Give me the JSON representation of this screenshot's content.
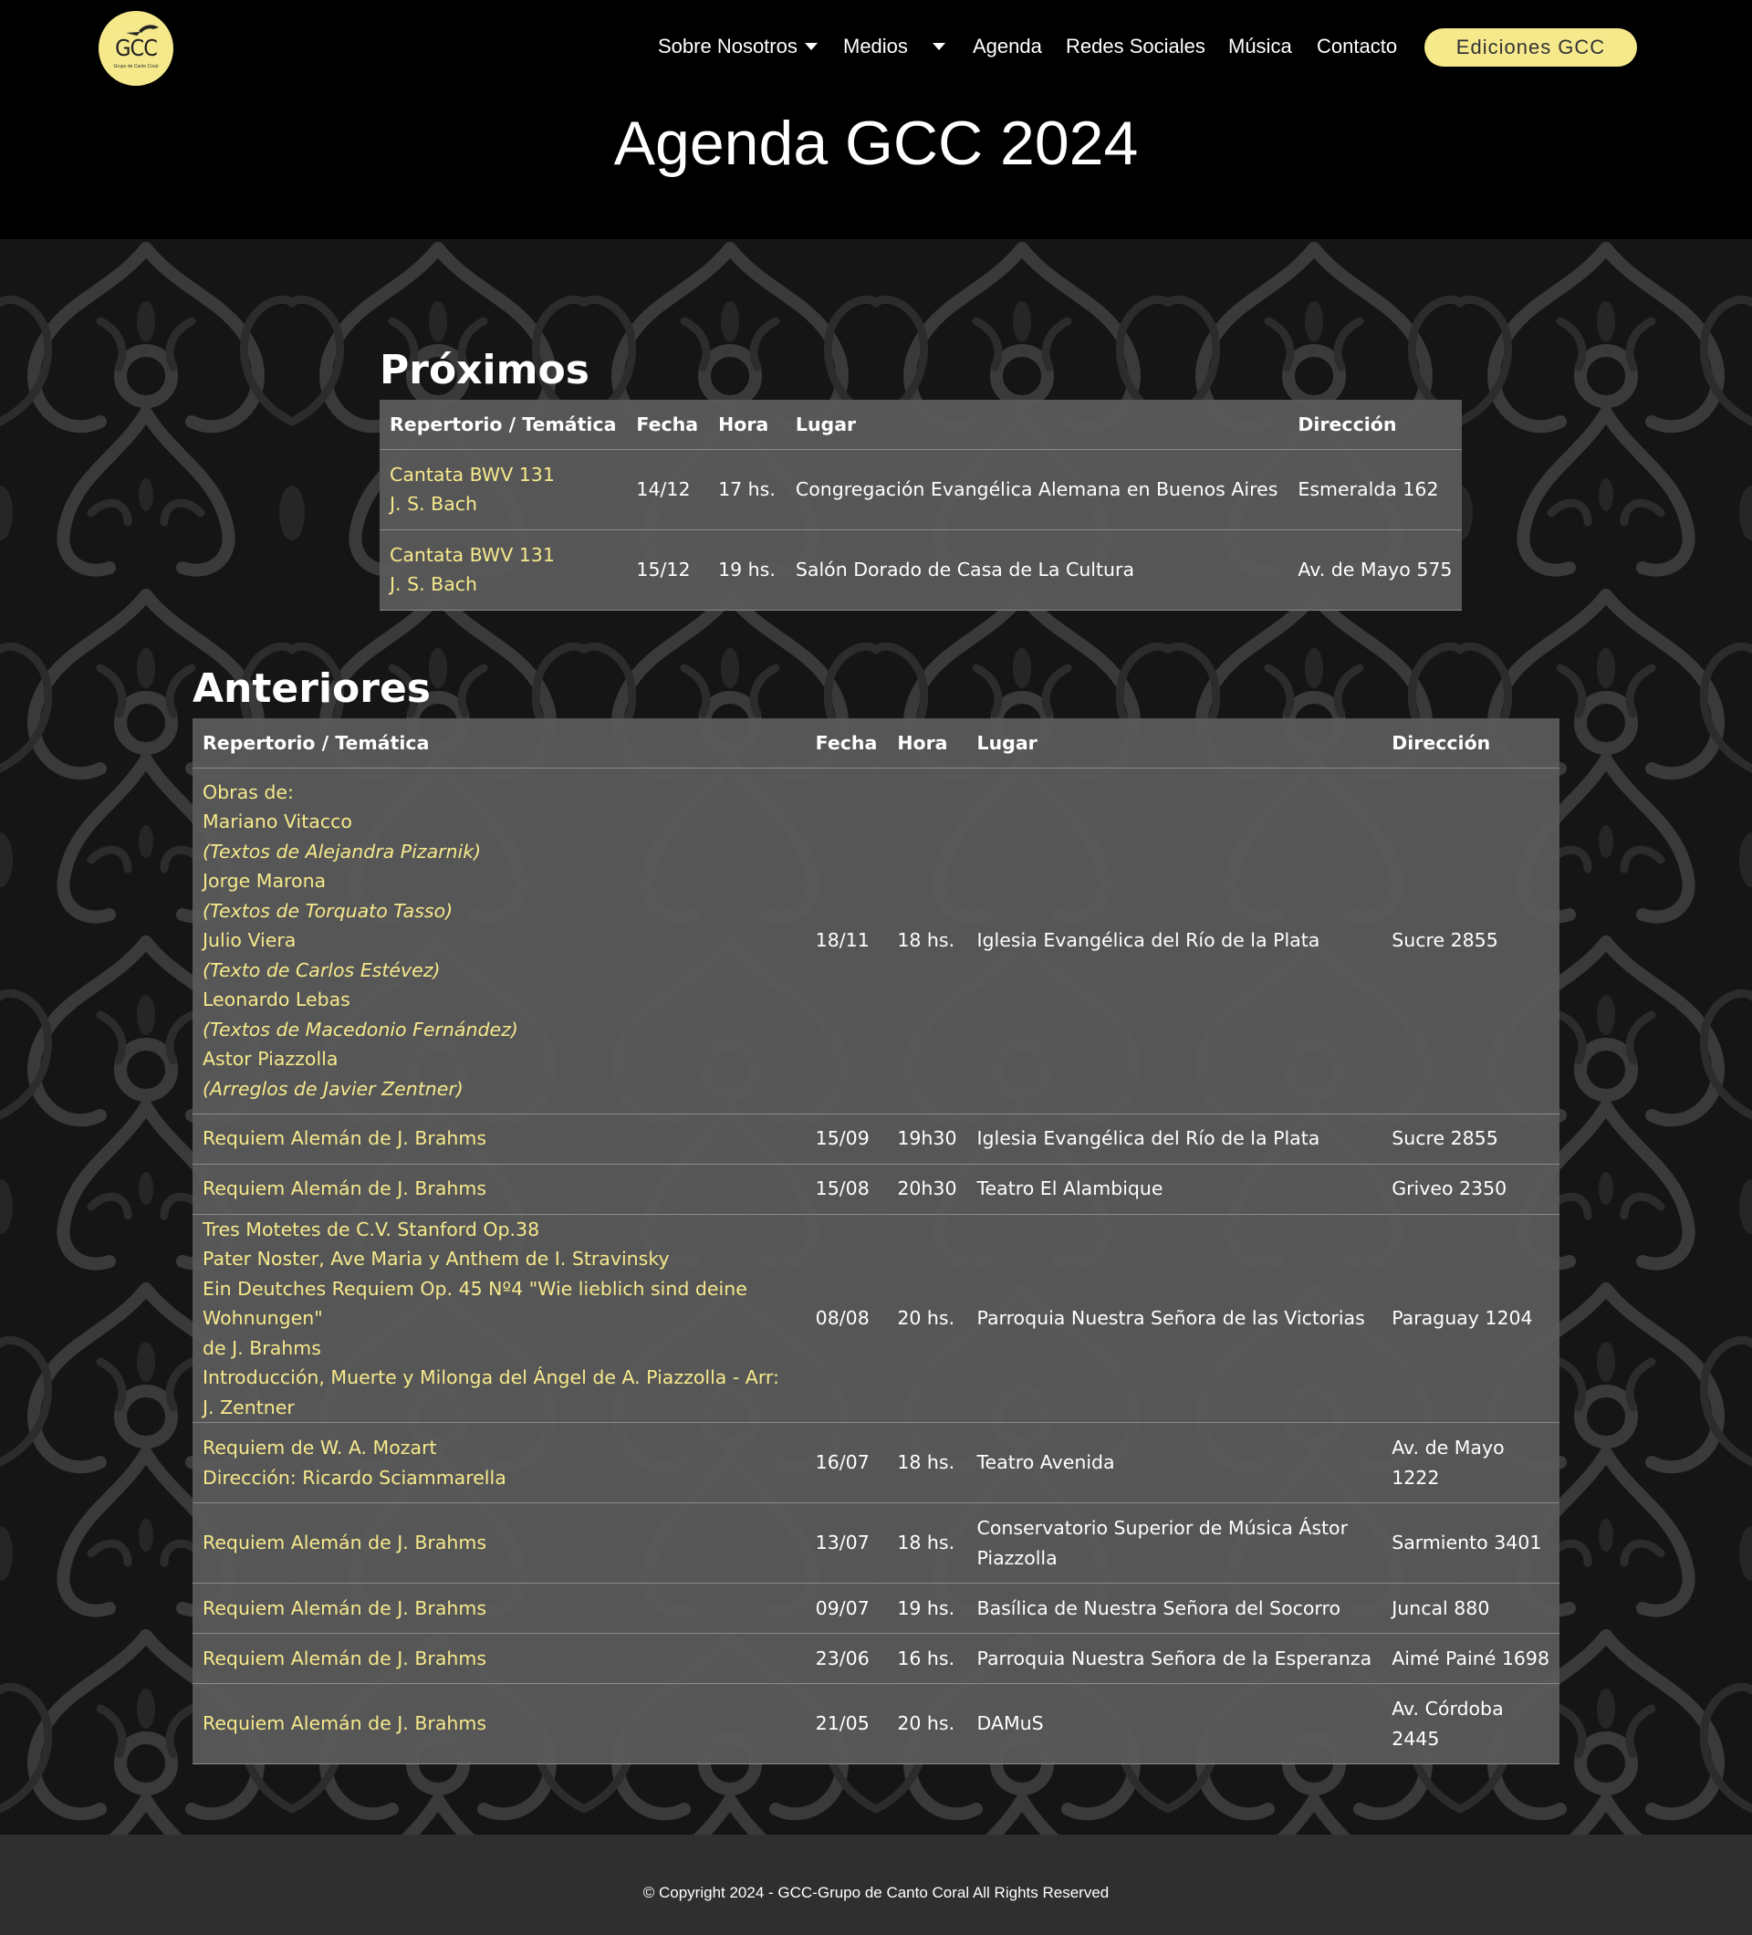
{
  "header": {
    "logo_text": "GCC",
    "logo_subtext": "Grupo de Canto Coral",
    "nav": {
      "sobre": "Sobre Nosotros",
      "medios": "Medios",
      "agenda": "Agenda",
      "redes": "Redes Sociales",
      "musica": "Música",
      "contacto": "Contacto"
    },
    "cta": "Ediciones GCC"
  },
  "page_title": "Agenda GCC 2024",
  "columns": {
    "rep": "Repertorio / Temática",
    "fecha": "Fecha",
    "hora": "Hora",
    "lugar": "Lugar",
    "dir": "Dirección"
  },
  "proximos": {
    "title": "Próximos",
    "rows": [
      {
        "rep1": "Cantata BWV 131",
        "rep2": "J. S. Bach",
        "fecha": "14/12",
        "hora": "17 hs.",
        "lugar": "Congregación Evangélica Alemana en Buenos Aires",
        "dir": "Esmeralda 162"
      },
      {
        "rep1": "Cantata BWV 131",
        "rep2": "J. S. Bach",
        "fecha": "15/12",
        "hora": "19 hs.",
        "lugar": "Salón Dorado de Casa de La Cultura",
        "dir": "Av. de Mayo 575"
      }
    ]
  },
  "anteriores": {
    "title": "Anteriores",
    "row1": {
      "lines": [
        "Obras de:",
        "Mariano Vitacco",
        "(Textos de Alejandra Pizarnik)",
        "Jorge Marona",
        "(Textos de Torquato Tasso)",
        "Julio Viera",
        "(Texto de Carlos Estévez)",
        "Leonardo Lebas",
        "(Textos de Macedonio Fernández)",
        "Astor Piazzolla",
        "(Arreglos de Javier Zentner)"
      ],
      "fecha": "18/11",
      "hora": "18 hs.",
      "lugar": "Iglesia Evangélica del Río de la Plata",
      "dir": "Sucre 2855"
    },
    "row2": {
      "rep": "Requiem Alemán de J. Brahms",
      "fecha": "15/09",
      "hora": "19h30",
      "lugar": "Iglesia Evangélica del Río de la Plata",
      "dir": "Sucre 2855"
    },
    "row3": {
      "rep": "Requiem Alemán de J. Brahms",
      "fecha": "15/08",
      "hora": "20h30",
      "lugar": "Teatro El Alambique",
      "dir": "Griveo 2350"
    },
    "row4": {
      "lines": [
        "Tres Motetes de C.V. Stanford Op.38",
        "Pater Noster, Ave Maria y Anthem de I. Stravinsky",
        "Ein Deutches Requiem Op. 45 Nº4 \"Wie lieblich sind deine Wohnungen\"",
        "de J. Brahms",
        "Introducción, Muerte y Milonga del Ángel de A. Piazzolla - Arr: J. Zentner"
      ],
      "fecha": "08/08",
      "hora": "20 hs.",
      "lugar": "Parroquia Nuestra Señora de las Victorias",
      "dir": "Paraguay 1204"
    },
    "row5": {
      "rep1": "Requiem de W. A. Mozart",
      "rep2": "Dirección: Ricardo Sciammarella",
      "fecha": "16/07",
      "hora": "18 hs.",
      "lugar": "Teatro Avenida",
      "dir1": "Av. de Mayo",
      "dir2": "1222"
    },
    "row6": {
      "rep": "Requiem Alemán de J. Brahms",
      "fecha": "13/07",
      "hora": "18 hs.",
      "lugar1": "Conservatorio Superior de Música Ástor",
      "lugar2": "Piazzolla",
      "dir": "Sarmiento 3401"
    },
    "row7": {
      "rep": "Requiem Alemán de J. Brahms",
      "fecha": "09/07",
      "hora": "19 hs.",
      "lugar": "Basílica de Nuestra Señora del Socorro",
      "dir": "Juncal 880"
    },
    "row8": {
      "rep": "Requiem Alemán de J. Brahms",
      "fecha": "23/06",
      "hora": "16 hs.",
      "lugar": "Parroquia Nuestra Señora de la Esperanza",
      "dir": "Aimé Painé 1698"
    },
    "row9": {
      "rep": "Requiem Alemán de J. Brahms",
      "fecha": "21/05",
      "hora": "20 hs.",
      "lugar": "DAMuS",
      "dir1": "Av. Córdoba",
      "dir2": "2445"
    }
  },
  "footer": {
    "text": "© Copyright 2024 - GCC-Grupo de Canto Coral All Rights Reserved"
  },
  "colors": {
    "accent": "#f6e98c",
    "table_bg": "#5a5a5a",
    "footer_bg": "#2f2f2f"
  }
}
